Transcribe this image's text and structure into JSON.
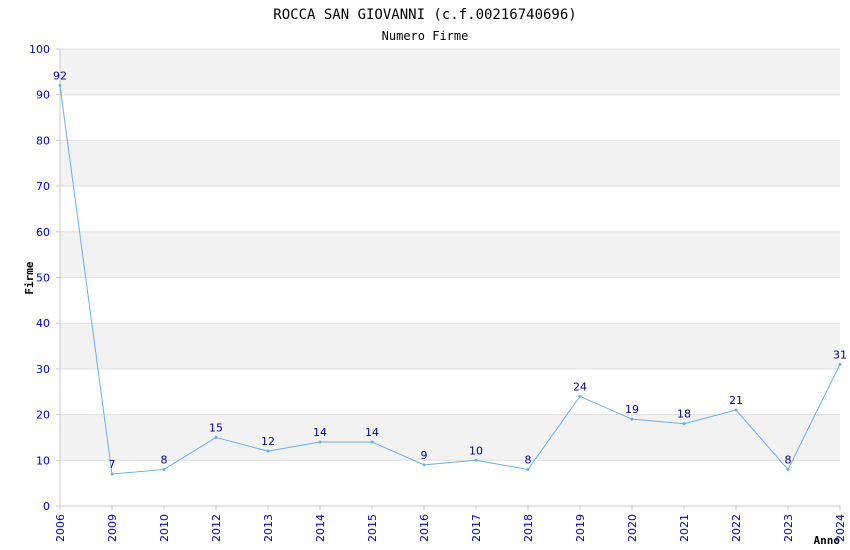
{
  "chart_data": {
    "type": "line",
    "title": "ROCCA SAN GIOVANNI (c.f.00216740696)",
    "subtitle": "Numero Firme",
    "xlabel": "Anno",
    "ylabel": "Firme",
    "categories": [
      "2006",
      "2009",
      "2010",
      "2012",
      "2013",
      "2014",
      "2015",
      "2016",
      "2017",
      "2018",
      "2019",
      "2020",
      "2021",
      "2022",
      "2023",
      "2024"
    ],
    "series": [
      {
        "values": [
          92,
          7,
          8,
          15,
          12,
          14,
          14,
          9,
          10,
          8,
          24,
          19,
          18,
          21,
          8,
          31
        ]
      }
    ],
    "ylim": [
      0,
      100
    ],
    "yticks": [
      "0",
      "10",
      "20",
      "30",
      "40",
      "50",
      "60",
      "70",
      "80",
      "90",
      "100"
    ],
    "grid": "horizontal, alternating bands",
    "colors": {
      "line": "#6aaee8",
      "band": "#f2f2f2",
      "tick_text": "#0000cc",
      "data_label": "#000080",
      "axis": "#c8c8c8"
    }
  }
}
